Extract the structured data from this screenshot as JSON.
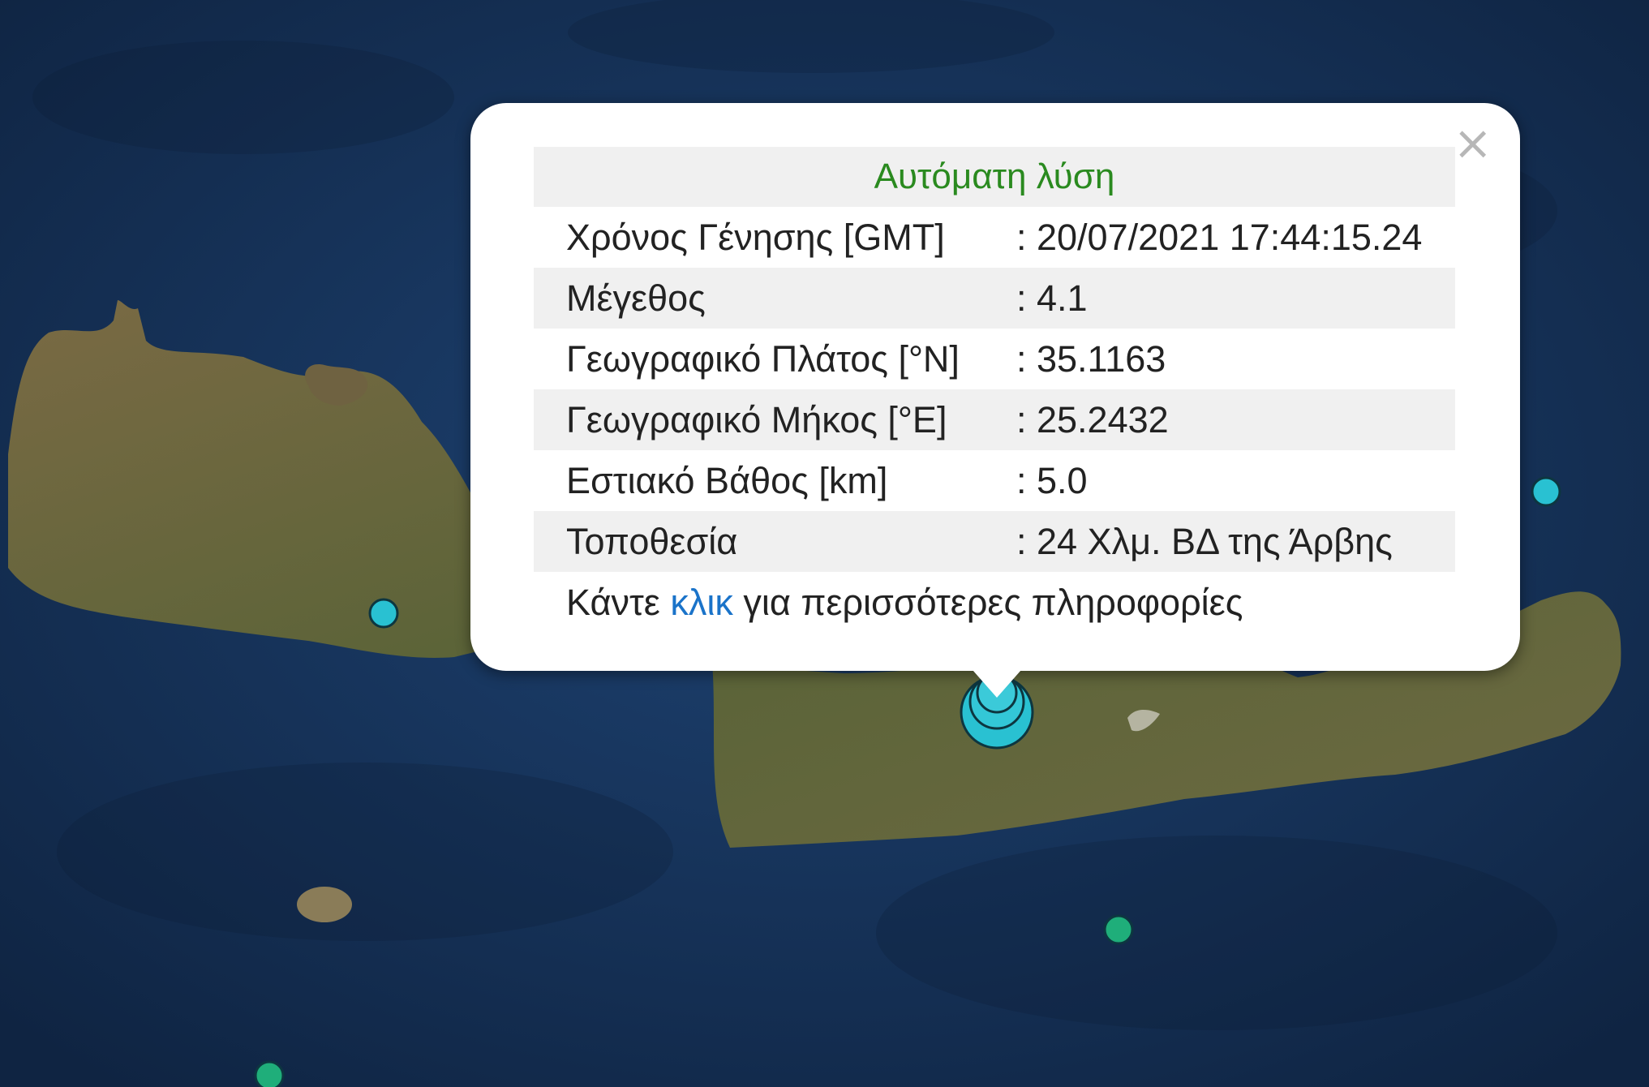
{
  "popup": {
    "title": "Αυτόματη λύση",
    "close_glyph": "×",
    "rows": [
      {
        "label": "Χρόνος Γένησης [GMT]",
        "value": ": 20/07/2021 17:44:15.24"
      },
      {
        "label": "Μέγεθος",
        "value": ": 4.1"
      },
      {
        "label": "Γεωγραφικό Πλάτος [°N]",
        "value": ": 35.1163"
      },
      {
        "label": "Γεωγραφικό Μήκος [°E]",
        "value": ": 25.2432"
      },
      {
        "label": "Εστιακό Βάθος [km]",
        "value": ": 5.0"
      },
      {
        "label": "Τοποθεσία",
        "value": ": 24 Χλμ. ΒΔ της Άρβης"
      }
    ],
    "more": {
      "before": "Κάντε ",
      "link": "κλικ",
      "after": " για περισσότερες πληροφορίες"
    }
  },
  "colors": {
    "sea": "#1b3a66",
    "land": "#6b6a3e",
    "quake_cyan": "#29c1d2",
    "quake_green": "#1fae7a",
    "title_green": "#2a8a1f",
    "link_blue": "#1a73c9"
  },
  "map": {
    "background": "satellite-imagery",
    "markers": [
      {
        "type": "main-event",
        "color": "cyan"
      },
      {
        "type": "event",
        "color": "cyan"
      },
      {
        "type": "event",
        "color": "cyan"
      },
      {
        "type": "event",
        "color": "green"
      },
      {
        "type": "event",
        "color": "green"
      }
    ]
  }
}
